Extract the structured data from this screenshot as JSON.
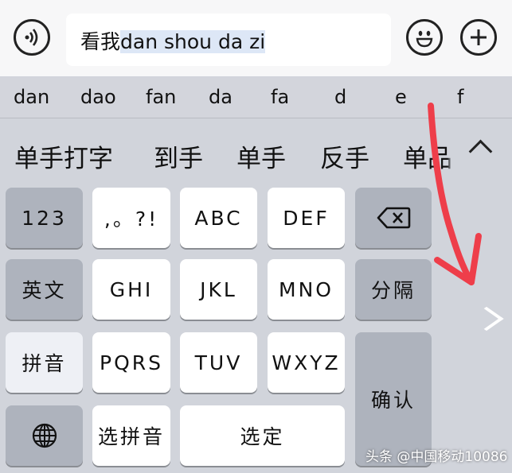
{
  "input": {
    "committed": "看我",
    "composing": "dan shou da zi"
  },
  "icons": {
    "voice": "voice-wave-icon",
    "emoji": "smile-emoji-icon",
    "plus": "plus-icon",
    "backspace": "backspace-icon",
    "globe": "globe-icon",
    "collapse": "chevron-up-icon",
    "side": "chevron-right-icon"
  },
  "pinyin_candidates": [
    "dan",
    "dao",
    "fan",
    "da",
    "fa",
    "d",
    "e",
    "f"
  ],
  "hanzi_candidates": [
    "单手打字",
    "到手",
    "单手",
    "反手",
    "单品"
  ],
  "keyboard": {
    "numbers": "123",
    "punct": ",。?!",
    "abc": "ABC",
    "def": "DEF",
    "english": "英文",
    "ghi": "GHI",
    "jkl": "JKL",
    "mno": "MNO",
    "separator": "分隔",
    "pinyin_mode": "拼音",
    "pqrs": "PQRS",
    "tuv": "TUV",
    "wxyz": "WXYZ",
    "confirm": "确认",
    "select_pinyin": "选拼音",
    "select": "选定"
  },
  "watermark": "头条 @中国移动10086",
  "colors": {
    "annotation_arrow": "#ee3e4a",
    "key_light": "#ffffff",
    "key_dark": "#aeb3bd"
  }
}
